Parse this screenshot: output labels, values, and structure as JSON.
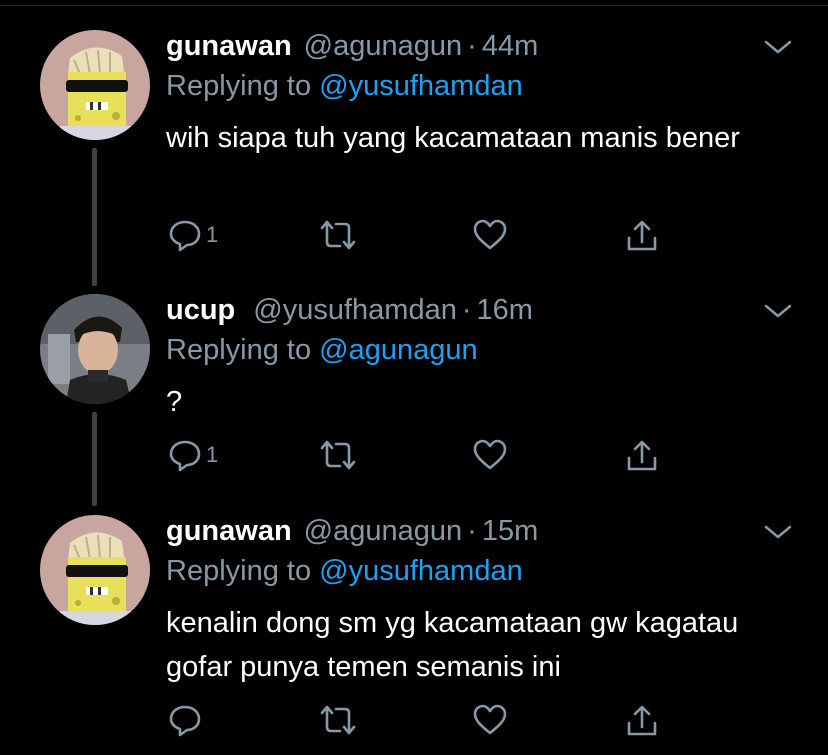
{
  "colors": {
    "background": "#000000",
    "muted": "#8899a6",
    "link": "#1da1f2",
    "thread_line": "#3d4246"
  },
  "tweets": [
    {
      "name": "gunawan",
      "handle": "@agunagun",
      "separator": "·",
      "time": "44m",
      "replying_prefix": "Replying to",
      "replying_to": "@yusufhamdan",
      "text": "wih siapa tuh yang kacamataan manis bener",
      "avatar_icon": "spongebob-sunglasses-avatar",
      "reply_count": "1",
      "retweet_count": "",
      "like_count": ""
    },
    {
      "name": "ucup",
      "handle": "@yusufhamdan",
      "separator": "·",
      "time": "16m",
      "replying_prefix": "Replying to",
      "replying_to": "@agunagun",
      "text": "?",
      "avatar_icon": "person-photo-avatar",
      "reply_count": "1",
      "retweet_count": "",
      "like_count": ""
    },
    {
      "name": "gunawan",
      "handle": "@agunagun",
      "separator": "·",
      "time": "15m",
      "replying_prefix": "Replying to",
      "replying_to": "@yusufhamdan",
      "text": "kenalin dong sm yg kacamataan gw kagatau gofar punya temen semanis ini",
      "avatar_icon": "spongebob-sunglasses-avatar",
      "reply_count": "",
      "retweet_count": "",
      "like_count": ""
    }
  ],
  "icons": {
    "reply": "reply-icon",
    "retweet": "retweet-icon",
    "like": "heart-icon",
    "share": "share-icon",
    "more": "chevron-down-icon"
  }
}
